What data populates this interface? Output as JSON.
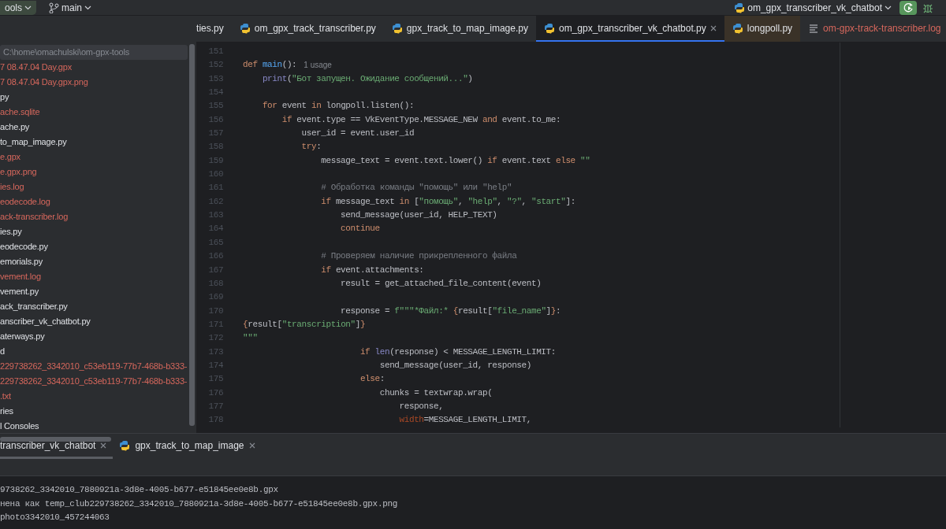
{
  "toolbar": {
    "project": "ools",
    "branch": "main",
    "run_config": "om_gpx_transcriber_vk_chatbot"
  },
  "project_tree": {
    "root_path": "C:\\home\\omachulski\\om-gpx-tools",
    "items": [
      {
        "name": "7 08.47.04 Day.gpx",
        "ignored": true
      },
      {
        "name": "7 08.47.04 Day.gpx.png",
        "ignored": true
      },
      {
        "name": "py",
        "ignored": false
      },
      {
        "name": "ache.sqlite",
        "ignored": true
      },
      {
        "name": "ache.py",
        "ignored": false
      },
      {
        "name": "to_map_image.py",
        "ignored": false
      },
      {
        "name": "e.gpx",
        "ignored": true
      },
      {
        "name": "e.gpx.png",
        "ignored": true
      },
      {
        "name": "ies.log",
        "ignored": true
      },
      {
        "name": "eodecode.log",
        "ignored": true
      },
      {
        "name": "ack-transcriber.log",
        "ignored": true
      },
      {
        "name": "ies.py",
        "ignored": false
      },
      {
        "name": "eodecode.py",
        "ignored": false
      },
      {
        "name": "emorials.py",
        "ignored": false
      },
      {
        "name": "vement.log",
        "ignored": true
      },
      {
        "name": "vement.py",
        "ignored": false
      },
      {
        "name": "ack_transcriber.py",
        "ignored": false
      },
      {
        "name": "anscriber_vk_chatbot.py",
        "ignored": false
      },
      {
        "name": "aterways.py",
        "ignored": false
      },
      {
        "name": "d",
        "ignored": false
      },
      {
        "name": "229738262_3342010_c53eb119-77b7-468b-b333-",
        "ignored": true
      },
      {
        "name": "229738262_3342010_c53eb119-77b7-468b-b333-",
        "ignored": true
      },
      {
        "name": ".txt",
        "ignored": true
      },
      {
        "name": "ries",
        "ignored": false
      },
      {
        "name": "l Consoles",
        "ignored": false
      }
    ]
  },
  "editor_tabs": [
    {
      "label": "ties.py",
      "kind": "none",
      "selected": false,
      "ignored": false
    },
    {
      "label": "om_gpx_track_transcriber.py",
      "kind": "python",
      "selected": false,
      "ignored": false
    },
    {
      "label": "gpx_track_to_map_image.py",
      "kind": "python",
      "selected": false,
      "ignored": false
    },
    {
      "label": "om_gpx_transcriber_vk_chatbot.py",
      "kind": "python",
      "selected": true,
      "ignored": false
    },
    {
      "label": "longpoll.py",
      "kind": "python",
      "selected": false,
      "ignored": false
    },
    {
      "label": "om-gpx-track-transcriber.log",
      "kind": "log",
      "selected": false,
      "ignored": true
    }
  ],
  "code_lines": [
    {
      "number": "151"
    },
    {
      "number": "152",
      "tokens": [
        {
          "kind": "kw",
          "text": "def "
        },
        {
          "kind": "fn",
          "text": "main"
        },
        {
          "kind": "plain",
          "text": "():"
        },
        {
          "kind": "hint",
          "text": "1 usage"
        }
      ]
    },
    {
      "number": "153",
      "tokens": [
        {
          "kind": "builtin",
          "text": "    print"
        },
        {
          "kind": "plain",
          "text": "("
        },
        {
          "kind": "str",
          "text": "\"Бот запущен. Ожидание сообщений...\""
        },
        {
          "kind": "plain",
          "text": ")"
        }
      ]
    },
    {
      "number": "154"
    },
    {
      "number": "155",
      "tokens": [
        {
          "kind": "kw",
          "text": "    for"
        },
        {
          "kind": "plain",
          "text": " event "
        },
        {
          "kind": "kw",
          "text": "in"
        },
        {
          "kind": "plain",
          "text": " longpoll.listen():"
        }
      ]
    },
    {
      "number": "156",
      "tokens": [
        {
          "kind": "kw",
          "text": "        if"
        },
        {
          "kind": "plain",
          "text": " event.type == VkEventType.MESSAGE_NEW "
        },
        {
          "kind": "kw",
          "text": "and"
        },
        {
          "kind": "plain",
          "text": " event.to_me:"
        }
      ]
    },
    {
      "number": "157",
      "tokens": [
        {
          "kind": "plain",
          "text": "            user_id = event.user_id"
        }
      ]
    },
    {
      "number": "158",
      "tokens": [
        {
          "kind": "kw",
          "text": "            try"
        },
        {
          "kind": "plain",
          "text": ":"
        }
      ]
    },
    {
      "number": "159",
      "tokens": [
        {
          "kind": "plain",
          "text": "                message_text = event.text.lower() "
        },
        {
          "kind": "kw",
          "text": "if"
        },
        {
          "kind": "plain",
          "text": " event.text "
        },
        {
          "kind": "kw",
          "text": "else "
        },
        {
          "kind": "str",
          "text": "\"\""
        }
      ]
    },
    {
      "number": "160"
    },
    {
      "number": "161",
      "tokens": [
        {
          "kind": "comment",
          "text": "                # Обработка команды \"помощь\" или \"help\""
        }
      ]
    },
    {
      "number": "162",
      "tokens": [
        {
          "kind": "kw",
          "text": "                if"
        },
        {
          "kind": "plain",
          "text": " message_text "
        },
        {
          "kind": "kw",
          "text": "in"
        },
        {
          "kind": "plain",
          "text": " ["
        },
        {
          "kind": "str",
          "text": "\"помощь\""
        },
        {
          "kind": "plain",
          "text": ", "
        },
        {
          "kind": "str",
          "text": "\"help\""
        },
        {
          "kind": "plain",
          "text": ", "
        },
        {
          "kind": "str",
          "text": "\"?\""
        },
        {
          "kind": "plain",
          "text": ", "
        },
        {
          "kind": "str",
          "text": "\"start\""
        },
        {
          "kind": "plain",
          "text": "]:"
        }
      ]
    },
    {
      "number": "163",
      "tokens": [
        {
          "kind": "plain",
          "text": "                    send_message(user_id, HELP_TEXT)"
        }
      ]
    },
    {
      "number": "164",
      "tokens": [
        {
          "kind": "kw",
          "text": "                    continue"
        }
      ]
    },
    {
      "number": "165"
    },
    {
      "number": "166",
      "tokens": [
        {
          "kind": "comment",
          "text": "                # Проверяем наличие прикрепленного файла"
        }
      ]
    },
    {
      "number": "167",
      "tokens": [
        {
          "kind": "kw",
          "text": "                if"
        },
        {
          "kind": "plain",
          "text": " event.attachments:"
        }
      ]
    },
    {
      "number": "168",
      "tokens": [
        {
          "kind": "plain",
          "text": "                    result = get_attached_file_content(event)"
        }
      ]
    },
    {
      "number": "169"
    },
    {
      "number": "170",
      "tokens": [
        {
          "kind": "plain",
          "text": "                    response = "
        },
        {
          "kind": "str",
          "text": "f\"\"\"*Файл:* "
        },
        {
          "kind": "kw",
          "text": "{"
        },
        {
          "kind": "plain",
          "text": "result["
        },
        {
          "kind": "str",
          "text": "\"file_name\""
        },
        {
          "kind": "plain",
          "text": "]"
        },
        {
          "kind": "kw",
          "text": "}"
        },
        {
          "kind": "plain",
          "text": ":"
        }
      ]
    },
    {
      "number": "171",
      "tokens": [
        {
          "kind": "kw",
          "text": "{"
        },
        {
          "kind": "plain",
          "text": "result["
        },
        {
          "kind": "str",
          "text": "\"transcription\""
        },
        {
          "kind": "plain",
          "text": "]"
        },
        {
          "kind": "kw",
          "text": "}"
        }
      ]
    },
    {
      "number": "172",
      "tokens": [
        {
          "kind": "str",
          "text": "\"\"\""
        }
      ]
    },
    {
      "number": "173",
      "tokens": [
        {
          "kind": "kw",
          "text": "                        if "
        },
        {
          "kind": "builtin",
          "text": "len"
        },
        {
          "kind": "plain",
          "text": "(response) < MESSAGE_LENGTH_LIMIT:"
        }
      ]
    },
    {
      "number": "174",
      "tokens": [
        {
          "kind": "plain",
          "text": "                            send_message(user_id, response)"
        }
      ]
    },
    {
      "number": "175",
      "tokens": [
        {
          "kind": "kw",
          "text": "                        else"
        },
        {
          "kind": "plain",
          "text": ":"
        }
      ]
    },
    {
      "number": "176",
      "tokens": [
        {
          "kind": "plain",
          "text": "                            chunks = textwrap.wrap("
        }
      ]
    },
    {
      "number": "177",
      "tokens": [
        {
          "kind": "plain",
          "text": "                                response,"
        }
      ]
    },
    {
      "number": "178",
      "tokens": [
        {
          "kind": "param",
          "text": "                                width"
        },
        {
          "kind": "plain",
          "text": "=MESSAGE_LENGTH_LIMIT,"
        }
      ]
    }
  ],
  "run_tabs": [
    {
      "label": "transcriber_vk_chatbot",
      "kind": "none",
      "selected": true
    },
    {
      "label": "gpx_track_to_map_image",
      "kind": "python",
      "selected": false
    }
  ],
  "console_lines": [
    "9738262_3342010_7880921a-3d8e-4005-b677-e51845ee0e8b.gpx",
    "нена как temp_club229738262_3342010_7880921a-3d8e-4005-b677-e51845ee0e8b.gpx.png",
    "photo3342010_457244063"
  ]
}
